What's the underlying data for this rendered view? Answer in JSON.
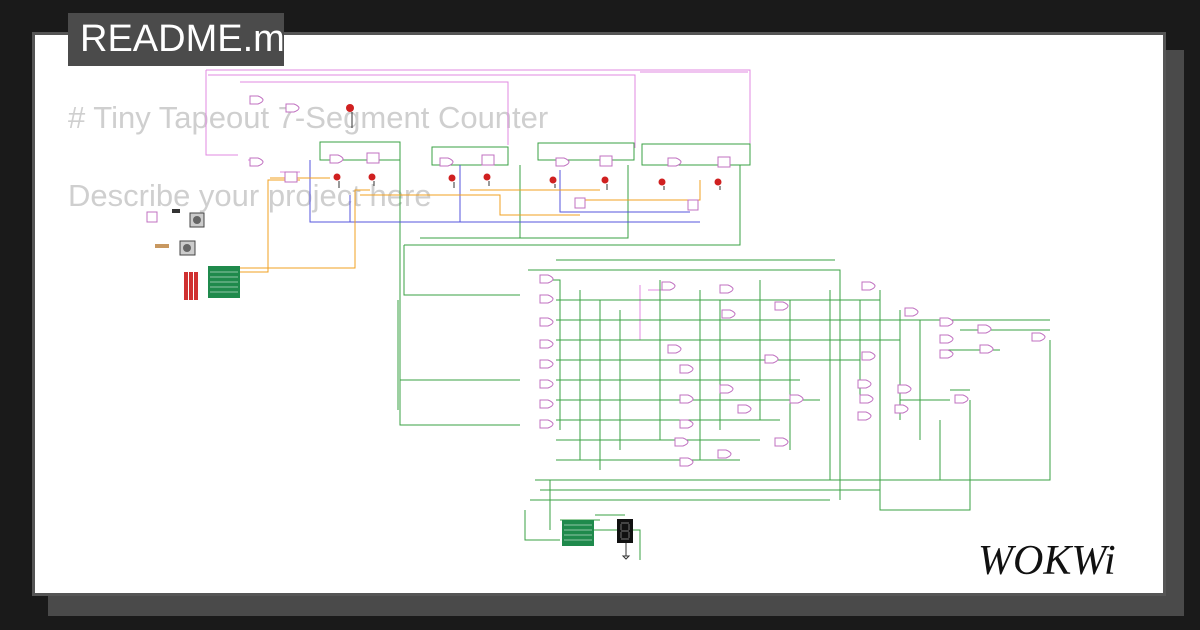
{
  "tab": {
    "label": "README.md"
  },
  "readme": {
    "heading": "# Tiny Tapeout 7-Segment Counter",
    "description": "Describe your project here"
  },
  "brand": {
    "logo_text": "WOKWi",
    "icon": "wokwi-logo"
  },
  "colors": {
    "background": "#1a1a1a",
    "card": "#ffffff",
    "tab": "#4b4b4b",
    "wire_green": "#3aa043",
    "wire_pink": "#e08ae0",
    "wire_blue": "#5555dd",
    "wire_orange": "#f0a020",
    "led_red": "#d02020",
    "chip_green": "#1f8a4c"
  }
}
